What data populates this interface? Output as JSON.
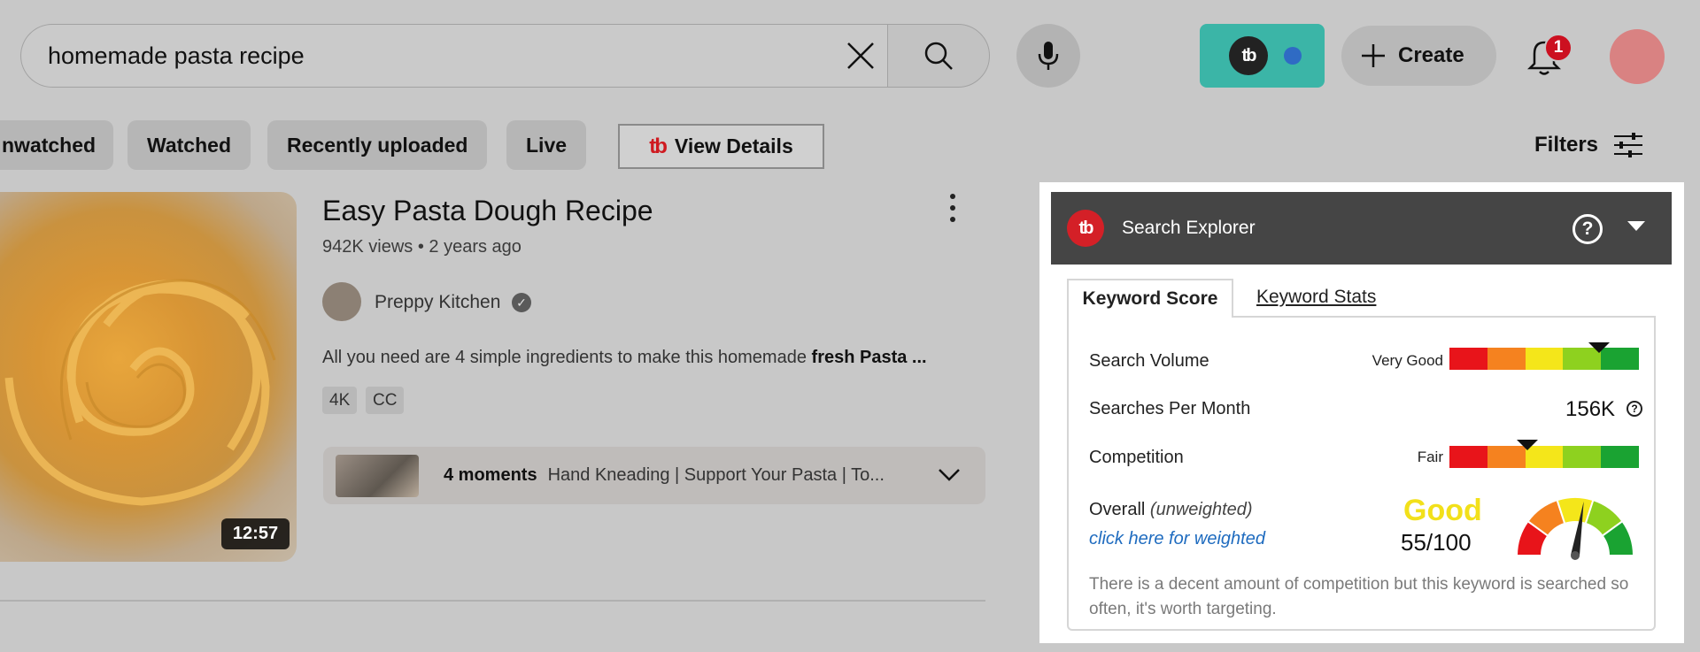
{
  "header": {
    "search_value": "homemade pasta recipe",
    "create_label": "Create",
    "notification_count": "1"
  },
  "chips": [
    "nwatched",
    "Watched",
    "Recently uploaded",
    "Live"
  ],
  "view_details_label": "View Details",
  "filters_label": "Filters",
  "video": {
    "title": "Easy Pasta Dough Recipe",
    "meta": "942K views • 2 years ago",
    "channel": "Preppy Kitchen",
    "description_plain": "All you need are 4 simple ingredients to make this homemade ",
    "description_bold": "fresh Pasta ...",
    "badges": [
      "4K",
      "CC"
    ],
    "duration": "12:57",
    "moments_count": "4 moments",
    "moments_text": "Hand Kneading | Support Your Pasta | To..."
  },
  "explorer": {
    "title": "Search Explorer",
    "help": "?",
    "tabs": {
      "active": "Keyword Score",
      "other": "Keyword Stats"
    },
    "search_volume": {
      "label": "Search Volume",
      "rating": "Very Good",
      "level": 0.79
    },
    "searches_per_month": {
      "label": "Searches Per Month",
      "value": "156K"
    },
    "competition": {
      "label": "Competition",
      "rating": "Fair",
      "level": 0.41
    },
    "overall": {
      "label": "Overall",
      "qualifier": "(unweighted)",
      "link": "click here for weighted",
      "grade": "Good",
      "score": "55/100",
      "score_value": 55
    },
    "note": "There is a decent amount of competition but this keyword is searched so often, it's worth targeting.",
    "meter_colors": [
      "#e8141a",
      "#f5821f",
      "#f4e61a",
      "#8ed11f",
      "#1aa332"
    ]
  }
}
